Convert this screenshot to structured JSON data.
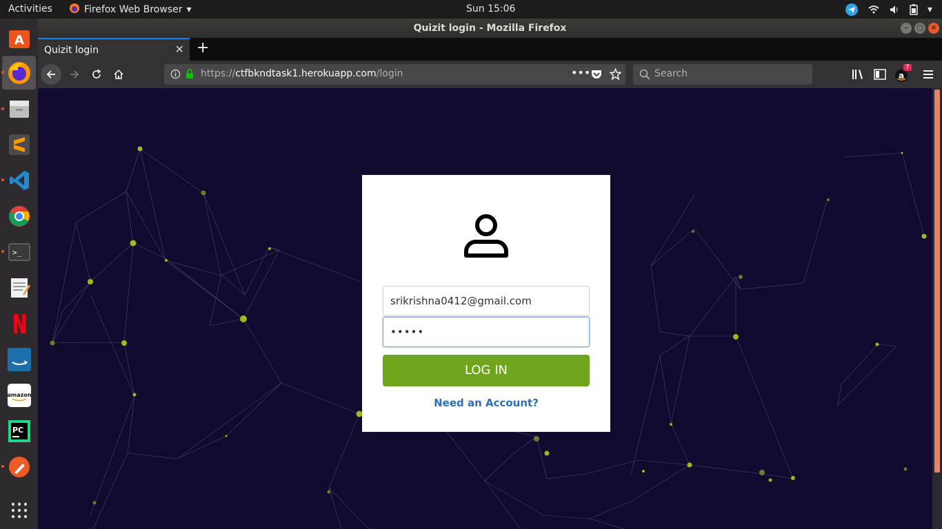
{
  "topbar": {
    "activities": "Activities",
    "app_name": "Firefox Web Browser",
    "clock": "Sun 15:06"
  },
  "window": {
    "title": "Quizit login - Mozilla Firefox"
  },
  "dock": {
    "items": [
      "software-center",
      "firefox",
      "files",
      "sublime-text",
      "vscode",
      "chrome",
      "terminal",
      "text-editor",
      "netflix",
      "amazon-prime",
      "amazon",
      "pycharm",
      "postman",
      "show-apps"
    ]
  },
  "browser": {
    "tab_label": "Quizit login",
    "url_scheme": "https://",
    "url_host": "ctfbkndtask1.herokuapp.com",
    "url_path": "/login",
    "search_placeholder": "Search",
    "badge_count": "7"
  },
  "login": {
    "email_value": "srikrishna0412@gmail.com",
    "password_mask": "•••••",
    "login_button": "LOG IN",
    "signup_link": "Need an Account?"
  },
  "colors": {
    "background": "#120a2e",
    "accent": "#6da51c",
    "link": "#2c6fb5",
    "node": "#a4b81c"
  }
}
